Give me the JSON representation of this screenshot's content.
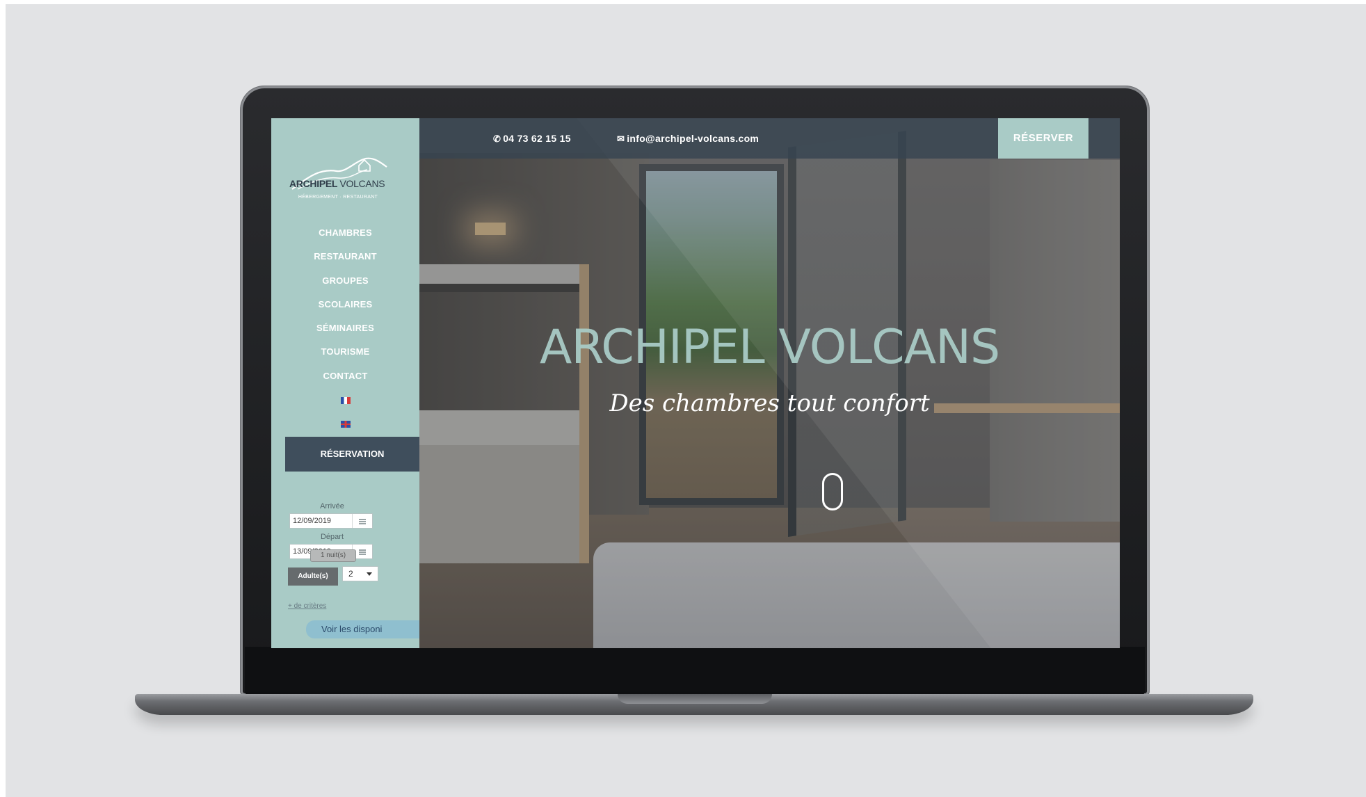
{
  "brand": {
    "name_bold": "ARCHIPEL",
    "name_light": "VOLCANS",
    "tagline": "HÉBERGEMENT · RESTAURANT"
  },
  "nav": {
    "items": [
      "CHAMBRES",
      "RESTAURANT",
      "GROUPES",
      "SCOLAIRES",
      "SÉMINAIRES",
      "TOURISME",
      "CONTACT"
    ],
    "flags": [
      "flag-fr-icon",
      "flag-en-icon"
    ]
  },
  "reservation": {
    "title": "RÉSERVATION",
    "arrival_label": "Arrivée",
    "arrival_value": "12/09/2019",
    "departure_label": "Départ",
    "departure_value": "13/09/2019",
    "nights": "1 nuit(s)",
    "adults_label": "Adulte(s)",
    "adults_value": "2",
    "more_criteria": "+ de critères",
    "check_button": "Voir les disponi"
  },
  "topbar": {
    "phone": "04 73 62 15 15",
    "email": "info@archipel-volcans.com",
    "book_button": "RÉSERVER"
  },
  "hero": {
    "title": "ARCHIPEL VOLCANS",
    "subtitle": "Des chambres tout confort"
  },
  "colors": {
    "sidebar": "#a9cbc6",
    "dark_slate": "#3f4e5c",
    "accent_button": "#8fbfcf"
  }
}
